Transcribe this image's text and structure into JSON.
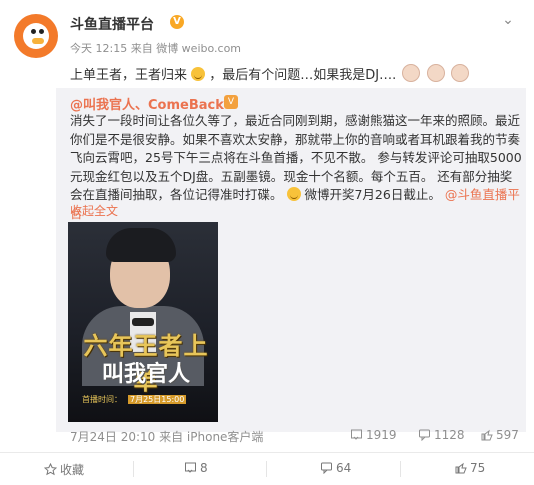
{
  "post": {
    "author": "斗鱼直播平台",
    "meta": "今天 12:15 来自 微博 weibo.com",
    "content_a": "上单王者，王者归来",
    "content_b": "，最后有个问题…如果我是DJ…."
  },
  "retweet": {
    "author": "@叫我官人、ComeBack",
    "text_main": "消失了一段时间让各位久等了，最近合同刚到期，感谢熊猫这一年来的照顾。最近你们是不是很安静。如果不喜欢太安静，那就带上你的音响或者耳机跟着我的节奏飞向云霄吧，25号下午三点将在斗鱼首播，不见不散。 参与转发评论可抽取5000元现金红包以及五个DJ盘。五副墨镜。现金十个名额。每个五百。 还有部分抽奖会在直播间抽取，各位记得准时打碟。",
    "text_end": "微博开奖7月26日截止。",
    "mention": "@斗鱼直播平台",
    "collapse_label": "收起全文",
    "footer": "7月24日 20:10 来自 iPhone客户端",
    "stats": {
      "repost": "1919",
      "comment": "1128",
      "like": "597"
    },
    "image": {
      "title_line1": "六年王者上单",
      "title_line2": "叫我官人",
      "airtime_label": "首播时间：",
      "airtime_value": "7月25日15:00"
    }
  },
  "actions": {
    "favorite": "收藏",
    "repost": "8",
    "comment": "64",
    "like": "75"
  },
  "icons": {
    "verified": "v-badge-icon",
    "dropdown": "chevron-down-icon"
  },
  "colors": {
    "link": "#eb7350",
    "badge": "#f9a825",
    "retweet_bg": "#f2f2f5"
  }
}
